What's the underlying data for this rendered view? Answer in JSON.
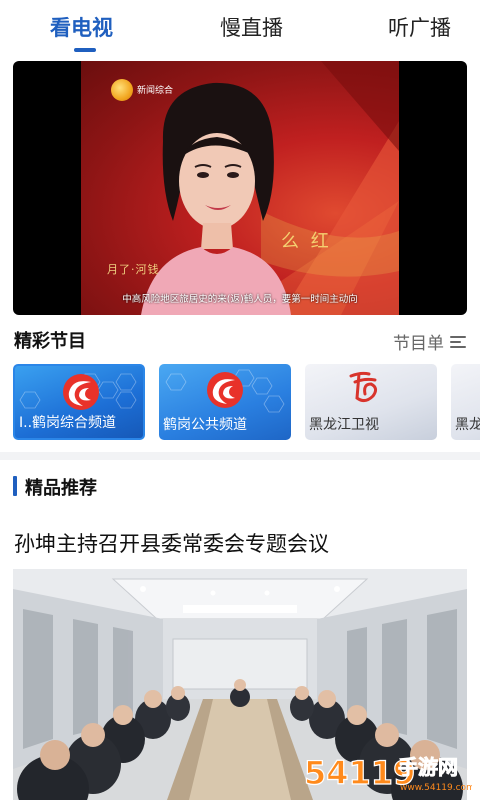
{
  "tabs": [
    {
      "label": "看电视",
      "active": true
    },
    {
      "label": "慢直播",
      "active": false
    },
    {
      "label": "听广播",
      "active": false
    }
  ],
  "player": {
    "channel_logo_text": "新闻综合",
    "overlay_text": "么 红",
    "lower_third_text": "月了·河钱",
    "subtitle": "中高风险地区旅居史的来(返)鹤人员，要第一时间主动向"
  },
  "programs": {
    "title": "精彩节目",
    "schedule_label": "节目单",
    "channels": [
      {
        "name": "鹤岗综合频道",
        "prefix": "I.."
      },
      {
        "name": "鹤岗公共频道"
      },
      {
        "name": "黑龙江卫视",
        "logo_text": "黑龙江卫视"
      },
      {
        "name": "黑龙"
      }
    ]
  },
  "recommend": {
    "title": "精品推荐",
    "items": [
      {
        "headline": "孙坤主持召开县委常委会专题会议"
      }
    ]
  },
  "watermark": {
    "number": "54119",
    "site": "手游网",
    "domain": "www.54119.com.cn"
  },
  "colors": {
    "accent": "#1f5fbf",
    "channel_blue": "#1d6fd6",
    "stage_red": "#c02020"
  },
  "icons": [
    "list-icon",
    "channel-emblem-icon",
    "play-area"
  ]
}
